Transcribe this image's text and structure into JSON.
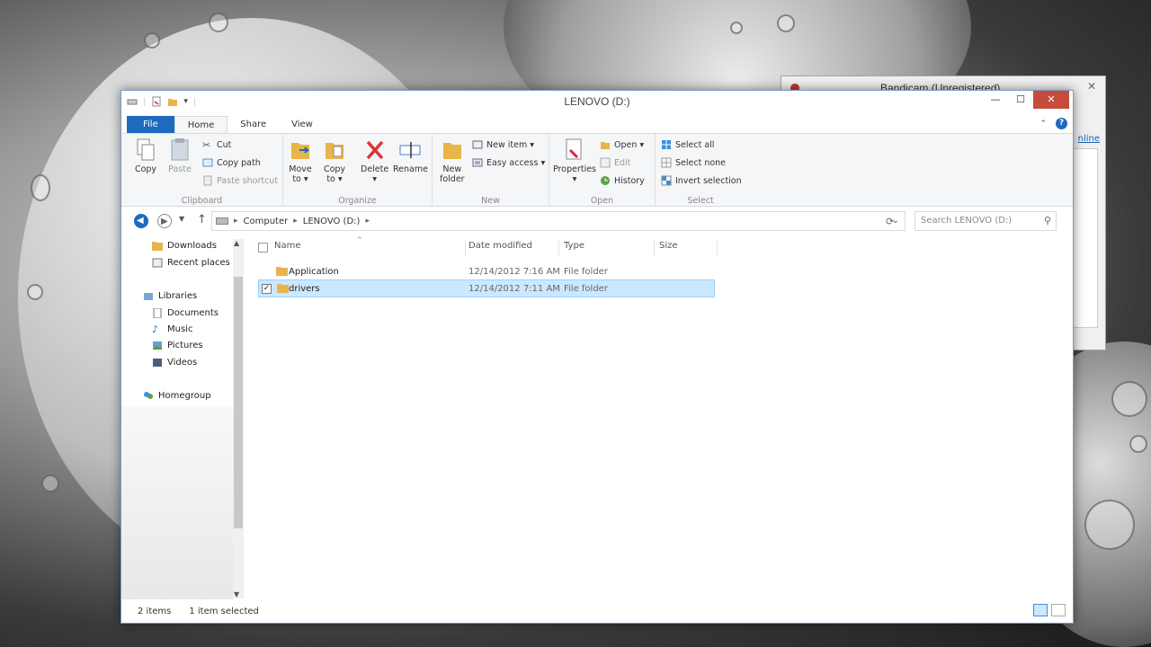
{
  "window": {
    "title": "LENOVO (D:)",
    "controls": {
      "minimize": "—",
      "maximize": "☐",
      "close": "✕"
    }
  },
  "bg_window": {
    "title": "Bandicam (Unregistered)",
    "link": "nline"
  },
  "tabs": [
    "File",
    "Home",
    "Share",
    "View"
  ],
  "ribbon": {
    "clipboard": {
      "label": "Clipboard",
      "copy": "Copy",
      "paste": "Paste",
      "cut": "Cut",
      "copy_path": "Copy path",
      "paste_shortcut": "Paste shortcut"
    },
    "organize": {
      "label": "Organize",
      "move_to": [
        "Move",
        "to ▾"
      ],
      "copy_to": [
        "Copy",
        "to ▾"
      ],
      "delete": [
        "Delete",
        "▾"
      ],
      "rename": "Rename"
    },
    "new": {
      "label": "New",
      "new_folder": [
        "New",
        "folder"
      ],
      "new_item": "New item ▾",
      "easy_access": "Easy access ▾"
    },
    "open": {
      "label": "Open",
      "properties": [
        "Properties",
        "▾"
      ],
      "open": "Open ▾",
      "edit": "Edit",
      "history": "History"
    },
    "select": {
      "label": "Select",
      "select_all": "Select all",
      "select_none": "Select none",
      "invert": "Invert selection"
    }
  },
  "address": {
    "crumbs": [
      "Computer",
      "LENOVO (D:)"
    ],
    "search_placeholder": "Search LENOVO (D:)"
  },
  "nav": {
    "items": [
      {
        "label": "Downloads",
        "icon": "downloads-folder-icon"
      },
      {
        "label": "Recent places",
        "icon": "recent-places-icon"
      },
      {
        "label": "Libraries",
        "icon": "libraries-icon"
      },
      {
        "label": "Documents",
        "icon": "documents-icon"
      },
      {
        "label": "Music",
        "icon": "music-icon"
      },
      {
        "label": "Pictures",
        "icon": "pictures-icon"
      },
      {
        "label": "Videos",
        "icon": "videos-icon"
      },
      {
        "label": "Homegroup",
        "icon": "homegroup-icon"
      }
    ]
  },
  "files": {
    "columns": [
      "Name",
      "Date modified",
      "Type",
      "Size"
    ],
    "rows": [
      {
        "name": "Application",
        "date": "12/14/2012 7:16 AM",
        "type": "File folder",
        "size": "",
        "selected": false
      },
      {
        "name": "drivers",
        "date": "12/14/2012 7:11 AM",
        "type": "File folder",
        "size": "",
        "selected": true
      }
    ]
  },
  "status": {
    "count": "2 items",
    "selected": "1 item selected"
  },
  "colors": {
    "accent": "#1c6bbf",
    "selection": "#cce8ff",
    "folder": "#e8b54a",
    "close": "#c74b3b"
  }
}
